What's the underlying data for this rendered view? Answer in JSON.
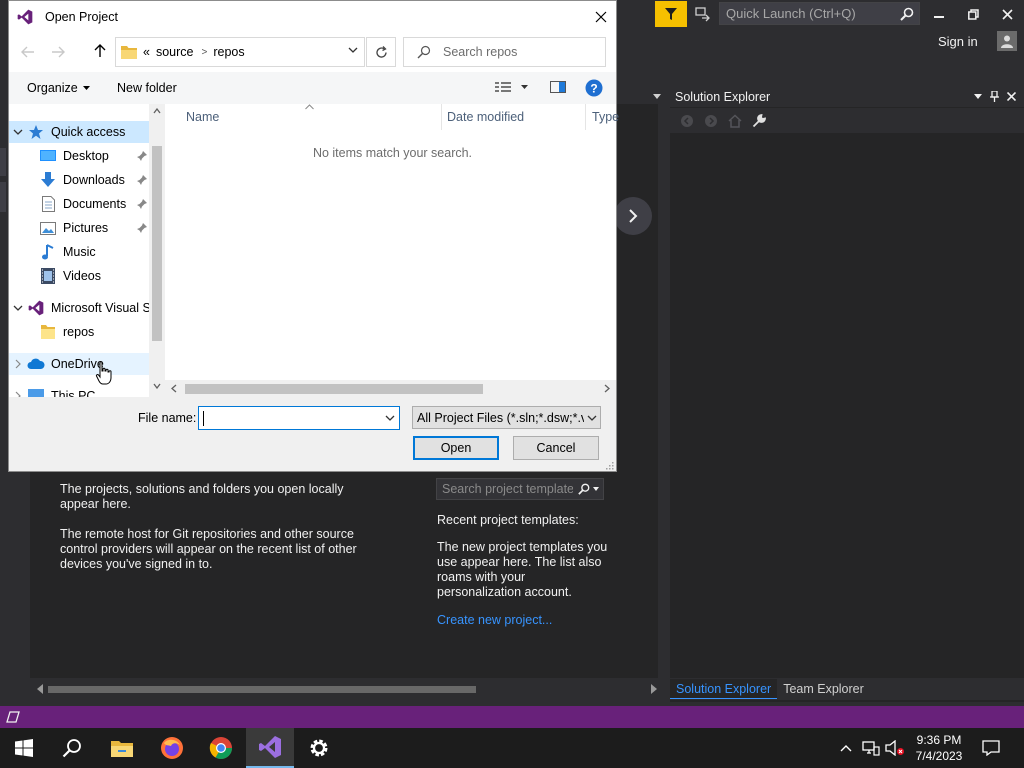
{
  "vs": {
    "quick_launch_placeholder": "Quick Launch (Ctrl+Q)",
    "sign_in": "Sign in",
    "accent_color": "#68217a",
    "start": {
      "open_local_text": "The projects, solutions and folders you open locally appear here.",
      "remote_text": "The remote host for Git repositories and other source control providers will appear on the recent list of other devices you've signed in to.",
      "search_templates_placeholder": "Search project templates",
      "recent_templates_title": "Recent project templates:",
      "recent_templates_text": "The new project templates you use appear here. The list also roams with your personalization account.",
      "create_new_project": "Create new project..."
    },
    "solution_explorer": {
      "title": "Solution Explorer",
      "tabs": [
        "Solution Explorer",
        "Team Explorer"
      ],
      "active_tab": 0
    }
  },
  "dialog": {
    "title": "Open Project",
    "breadcrumb": {
      "overflow": "«",
      "items": [
        "source",
        "repos"
      ]
    },
    "search_placeholder": "Search repos",
    "toolbar": {
      "organize": "Organize",
      "new_folder": "New folder"
    },
    "nav_items": [
      {
        "label": "Quick access",
        "icon": "star-icon",
        "expanded": true,
        "selected": true
      },
      {
        "label": "Desktop",
        "icon": "desktop-icon",
        "pinned": true
      },
      {
        "label": "Downloads",
        "icon": "download-icon",
        "pinned": true
      },
      {
        "label": "Documents",
        "icon": "documents-icon",
        "pinned": true
      },
      {
        "label": "Pictures",
        "icon": "pictures-icon",
        "pinned": true
      },
      {
        "label": "Music",
        "icon": "music-icon"
      },
      {
        "label": "Videos",
        "icon": "videos-icon"
      },
      {
        "label": "Microsoft Visual S",
        "icon": "visual-studio-icon",
        "expanded": true
      },
      {
        "label": "repos",
        "icon": "folder-icon"
      },
      {
        "label": "OneDrive",
        "icon": "onedrive-icon",
        "hovered": true
      },
      {
        "label": "This PC",
        "icon": "computer-icon"
      }
    ],
    "columns": [
      "Name",
      "Date modified",
      "Type"
    ],
    "empty_message": "No items match your search.",
    "file_name_label": "File name:",
    "file_name_value": "",
    "file_type": "All Project Files (*.sln;*.dsw;*.vcxproj",
    "open_button": "Open",
    "cancel_button": "Cancel"
  },
  "taskbar": {
    "apps": [
      "start-icon",
      "search-icon",
      "file-explorer-icon",
      "firefox-icon",
      "chrome-icon",
      "visual-studio-icon",
      "settings-icon"
    ],
    "time": "9:36 PM",
    "date": "7/4/2023"
  }
}
